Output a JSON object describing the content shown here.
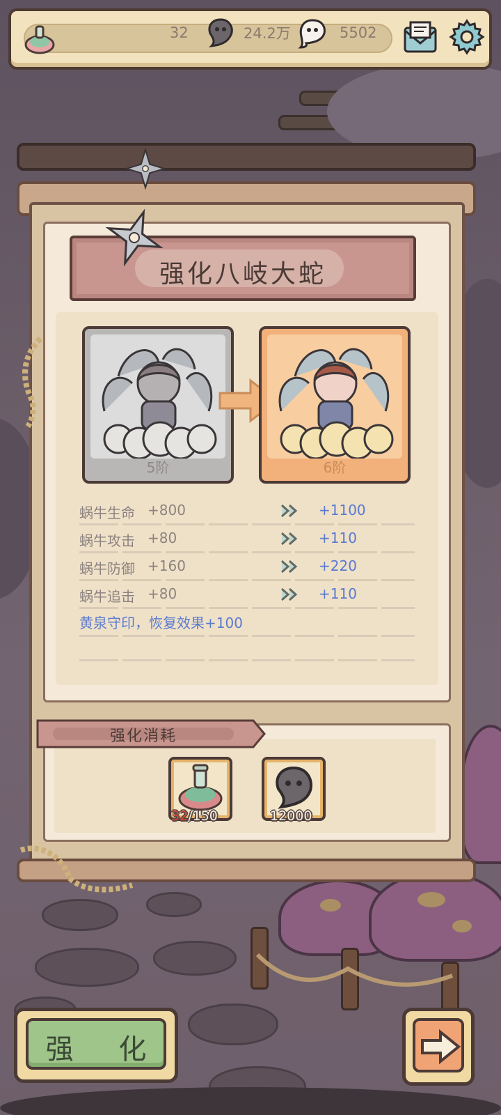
{
  "topbar": {
    "potion_count": "32",
    "snail_coins": "24.2万",
    "bubble_count": "5502",
    "icons": [
      "potion-icon",
      "snail-coin-icon",
      "speech-bubble-icon",
      "mail-icon",
      "gear-icon"
    ]
  },
  "panel": {
    "title": "强化八岐大蛇",
    "before": {
      "tier": "5阶"
    },
    "after": {
      "tier": "6阶"
    },
    "stats": [
      {
        "name": "蜗牛生命",
        "base": "+800",
        "new": "+1100"
      },
      {
        "name": "蜗牛攻击",
        "base": "+80",
        "new": "+110"
      },
      {
        "name": "蜗牛防御",
        "base": "+160",
        "new": "+220"
      },
      {
        "name": "蜗牛追击",
        "base": "+80",
        "new": "+110"
      }
    ],
    "extra": "黄泉守印，恢复效果+100"
  },
  "cost": {
    "label": "强化消耗",
    "items": [
      {
        "icon": "potion-icon",
        "have": "32",
        "need": "/150"
      },
      {
        "icon": "snail-coin-icon",
        "qty": "12000"
      }
    ]
  },
  "buttons": {
    "upgrade": "强 化",
    "next_icon": "arrow-right-icon"
  },
  "colors": {
    "paper": "#f5ead9",
    "banner": "#c8968f",
    "stat_new": "#5a7ad0",
    "upgrade_button": "#9fc58a",
    "next_button": "#f0a476",
    "have_insufficient": "#e0423a"
  }
}
